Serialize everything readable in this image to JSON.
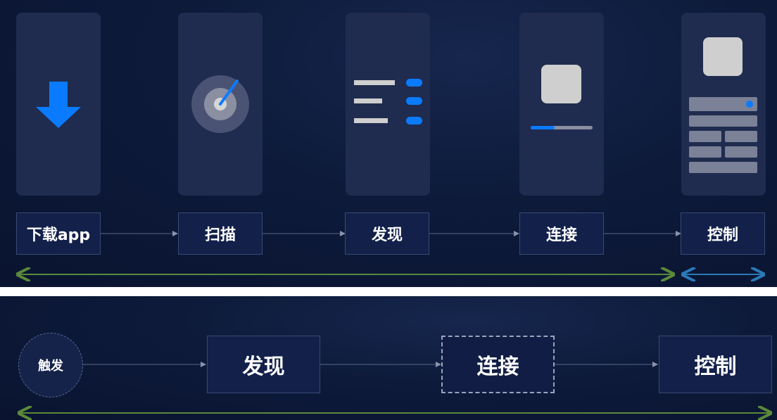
{
  "top_flow": {
    "steps": [
      {
        "label": "下载app",
        "icon": "download-arrow-icon"
      },
      {
        "label": "扫描",
        "icon": "radar-scan-icon"
      },
      {
        "label": "发现",
        "icon": "device-list-icon"
      },
      {
        "label": "连接",
        "icon": "connect-progress-icon"
      },
      {
        "label": "控制",
        "icon": "control-panel-icon"
      }
    ]
  },
  "bottom_flow": {
    "trigger": "触发",
    "steps": [
      "发现",
      "连接",
      "控制"
    ]
  },
  "colors": {
    "background": "#0d1a3a",
    "accent_blue": "#0a7bff",
    "span_green": "#5a8a3a",
    "span_blue": "#2a7ab8",
    "placeholder_gray": "#cfcfcf"
  }
}
